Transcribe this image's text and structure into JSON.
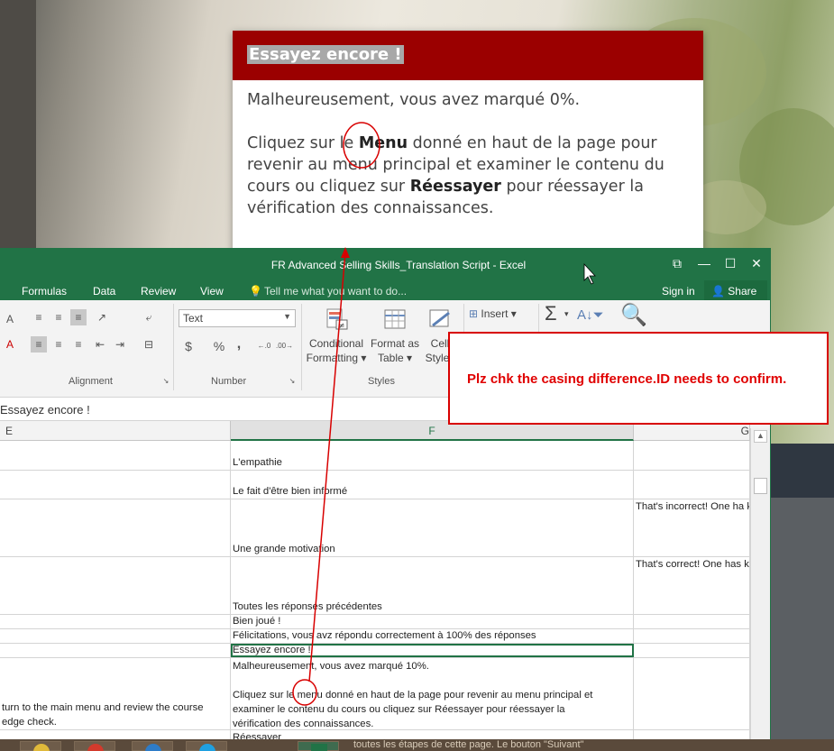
{
  "dialog": {
    "title": "Essayez encore !",
    "score_text": "Malheureusement, vous avez marqué 0%.",
    "para_pre": "Cliquez sur le ",
    "menu_word": "Menu",
    "para_mid": " donné en haut de la page pour revenir au menu principal et examiner le contenu du cours ou cliquez sur ",
    "retry_word": "Réessayer",
    "para_post": " pour réessayer la vérification des connaissances."
  },
  "excel": {
    "window_title": "FR Advanced Selling Skills_Translation Script - Excel",
    "title_controls": [
      "⧉",
      "—",
      "☐",
      "✕"
    ],
    "menu_tabs": [
      "Formulas",
      "Data",
      "Review",
      "View"
    ],
    "tell_me": "Tell me what you want to do...",
    "sign_in": "Sign in",
    "share": "Share",
    "ribbon": {
      "alignment_label": "Alignment",
      "number_label": "Number",
      "styles_label": "Styles",
      "number_format": "Text",
      "currency": "$",
      "percent": "%",
      "comma": ",",
      "insert": "Insert",
      "conditional_formatting": [
        "Conditional",
        "Formatting"
      ],
      "format_as_table": [
        "Format as",
        "Table"
      ],
      "cell_styles": [
        "Cell",
        "Styles"
      ]
    },
    "formula_bar_value": "Essayez encore !",
    "columns": [
      "E",
      "F",
      "G"
    ],
    "rows": [
      {
        "e": "",
        "f": "L'empathie",
        "g": ""
      },
      {
        "e": "",
        "f": "Le fait d'être bien informé",
        "g": ""
      },
      {
        "e": "",
        "f": "Une grande motivation",
        "g": "That's incorrect! One ha\nknowledgeable and hig\ngood sales professiona"
      },
      {
        "e": "",
        "f": "Toutes les réponses précédentes",
        "g": "That's correct! One has\nknowledgeable and hig\ngood sales professiona"
      },
      {
        "e": "",
        "f": "Bien joué !",
        "g": ""
      },
      {
        "e": "",
        "f": "Félicitations, vous avz répondu correctement à 100% des réponses",
        "g": ""
      },
      {
        "e": "",
        "f": "Essayez encore !",
        "g": ""
      },
      {
        "e": "turn to the main menu and review the course\nedge check.",
        "f": "Malheureusement, vous avez marqué 10%.\n\nCliquez sur le menu donné en haut de la page pour revenir au menu principal et\nexaminer le contenu du cours ou cliquez sur Réessayer pour réessayer la\nvérification des connaissances.",
        "g": ""
      },
      {
        "e": "",
        "f": "Réessayer",
        "g": ""
      }
    ]
  },
  "note": {
    "text": "Plz chk the casing difference.ID needs to confirm."
  },
  "taskbar": {
    "message": "toutes les étapes de cette page. Le bouton \"Suivant\""
  },
  "colors": {
    "dialog_header": "#9b0000",
    "excel_green": "#217346",
    "annotation_red": "#d80000"
  }
}
